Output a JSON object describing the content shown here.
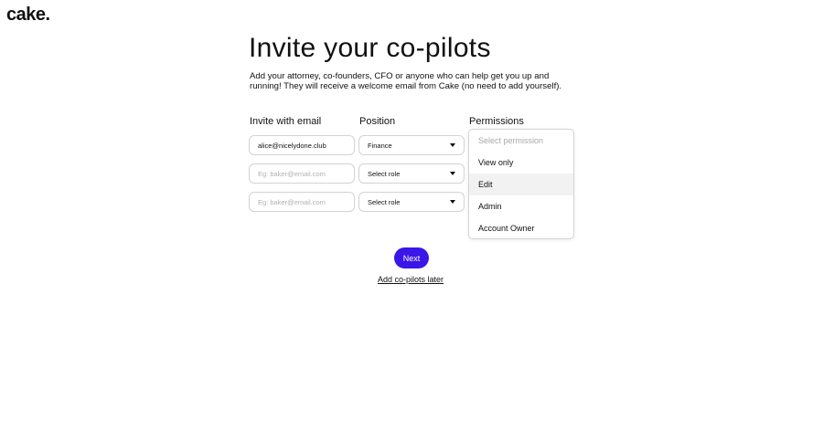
{
  "brand": {
    "logo": "cake."
  },
  "page": {
    "title": "Invite your co-pilots",
    "subtitle": "Add your attorney, co-founders, CFO or anyone who can help get you up and running! They will receive a welcome email from Cake (no need to add yourself)."
  },
  "columns": {
    "email": "Invite with email",
    "position": "Position",
    "permissions": "Permissions"
  },
  "rows": [
    {
      "email_value": "alice@nicelydone.club",
      "email_placeholder": "Eg: baker@email.com",
      "position": "Finance"
    },
    {
      "email_value": "",
      "email_placeholder": "Eg: baker@email.com",
      "position": "Select role"
    },
    {
      "email_value": "",
      "email_placeholder": "Eg: baker@email.com",
      "position": "Select role"
    }
  ],
  "permissions_dropdown": {
    "placeholder": "Select permission",
    "options": [
      "View only",
      "Edit",
      "Admin",
      "Account Owner"
    ],
    "highlighted": "Edit"
  },
  "actions": {
    "next": "Next",
    "later": "Add co-pilots later"
  }
}
